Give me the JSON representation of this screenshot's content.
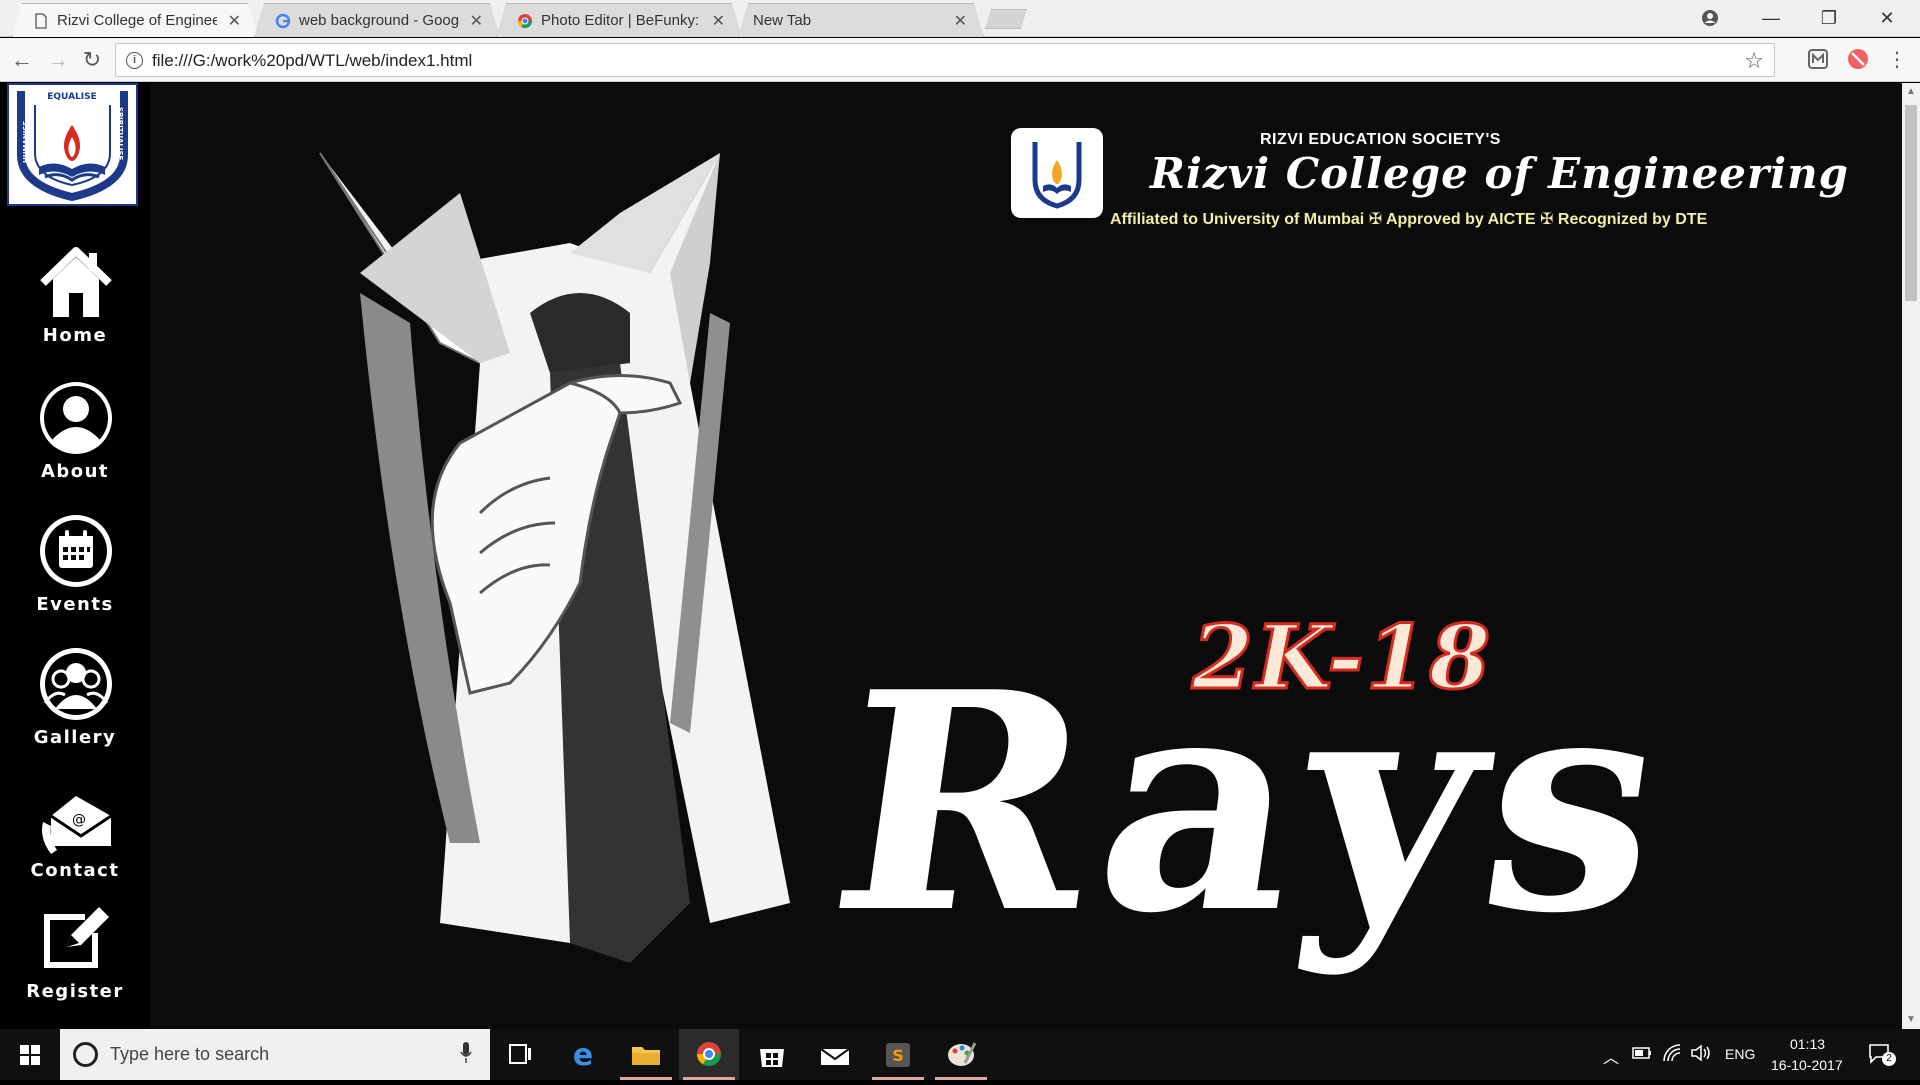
{
  "browser": {
    "tabs": [
      {
        "title": "Rizvi College of Engineer",
        "active": true
      },
      {
        "title": "web background - Goog",
        "active": false
      },
      {
        "title": "Photo Editor | BeFunky: F",
        "active": false
      },
      {
        "title": "New Tab",
        "active": false
      }
    ],
    "url": "file:///G:/work%20pd/WTL/web/index1.html"
  },
  "sidebar": {
    "items": [
      {
        "label": "Home",
        "icon": "home-icon"
      },
      {
        "label": "About",
        "icon": "user-icon"
      },
      {
        "label": "Events",
        "icon": "calendar-icon"
      },
      {
        "label": "Gallery",
        "icon": "group-icon"
      },
      {
        "label": "Contact",
        "icon": "contact-mail-icon"
      },
      {
        "label": "Register",
        "icon": "edit-icon"
      }
    ]
  },
  "logo": {
    "words": [
      "HUMANISE",
      "EQUALISE",
      "SPIRITUALISE"
    ]
  },
  "college": {
    "society": "RIZVI EDUCATION SOCIETY'S",
    "name": "Rizvi College of Engineering",
    "affiliation": "Affiliated to University of Mumbai  ✠  Approved by AICTE  ✠  Recognized by DTE"
  },
  "event": {
    "year": "2K-18",
    "title": "Rays"
  },
  "taskbar": {
    "search_placeholder": "Type here to search",
    "lang": "ENG",
    "time": "01:13",
    "date": "16-10-2017",
    "notifications": "2"
  },
  "colors": {
    "accent_red": "#d52b1e",
    "affil_yellow": "#f2f0a6",
    "logo_blue": "#1d3a8a"
  }
}
